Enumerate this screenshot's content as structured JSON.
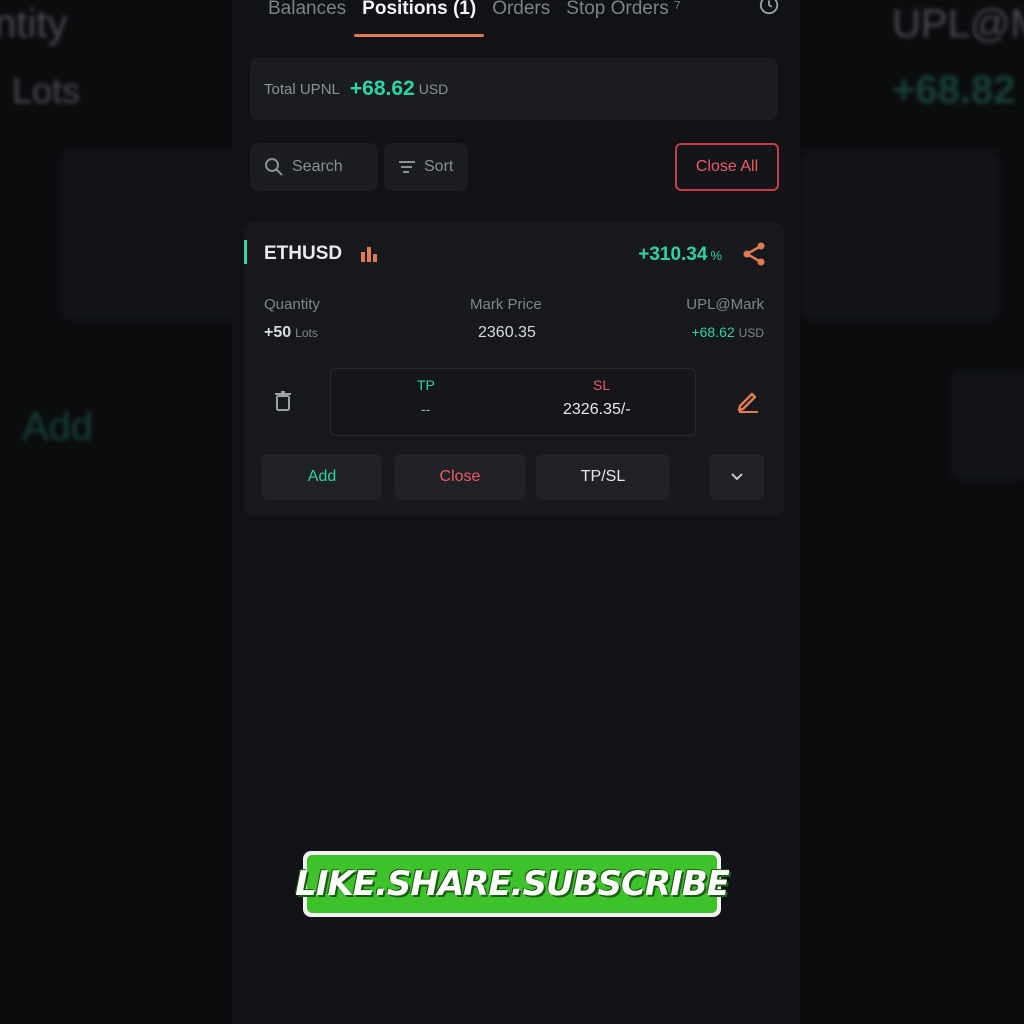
{
  "background_echo": {
    "left_texts": [
      "ntity",
      "Lots",
      "Add"
    ],
    "right_texts": [
      "UPL@M",
      "+68.82"
    ]
  },
  "tabs": [
    {
      "label": "Balances"
    },
    {
      "label": "Positions (1)"
    },
    {
      "label": "Orders"
    },
    {
      "label": "Stop Orders ⁷"
    }
  ],
  "summary": {
    "label": "Total UPNL",
    "value": "+68.62",
    "unit": "USD"
  },
  "toolbar": {
    "search_label": "Search",
    "sort_label": "Sort",
    "close_all_label": "Close All"
  },
  "position": {
    "symbol": "ETHUSD",
    "pnl_percent": "+310.34",
    "pnl_unit": "%",
    "quantity_label": "Quantity",
    "quantity_value": "+50",
    "quantity_unit": "Lots",
    "mark_price_label": "Mark Price",
    "mark_price_value": "2360.35",
    "upl_label": "UPL@Mark",
    "upl_value": "+68.62",
    "upl_unit": "USD",
    "tp_label": "TP",
    "tp_value": "--",
    "sl_label": "SL",
    "sl_value": "2326.35/-",
    "buttons": {
      "add": "Add",
      "close": "Close",
      "tpsl": "TP/SL"
    }
  },
  "overlay": {
    "subscribe_text": "LIKE.SHARE.SUBSCRIBE"
  },
  "colors": {
    "positive": "#2fd3a5",
    "negative": "#ef5a68",
    "accent": "#e07b52",
    "banner_green": "#3ec22c"
  }
}
